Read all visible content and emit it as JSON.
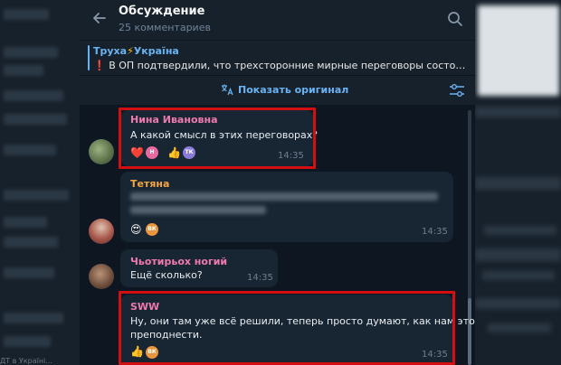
{
  "header": {
    "title": "Обсуждение",
    "subtitle": "25 комментариев"
  },
  "pinned": {
    "channel_part1": "Труха",
    "channel_emoji": "⚡",
    "channel_part2": "Україна",
    "mark": "❗",
    "text": "В ОП подтвердили, что трехсторонние мирные переговоры состоятся в ..."
  },
  "translate_bar": {
    "label": "Показать оригинал"
  },
  "messages": [
    {
      "author": "Нина Ивановна",
      "author_color": "#ee7aae",
      "text": "А какой смысл в этих переговорах?",
      "time": "14:35",
      "reactions": [
        {
          "emoji": "❤️",
          "avatar_initial": "Н",
          "avatar_color": "#e96a9e"
        },
        {
          "emoji": "👍",
          "avatar_initial": "ТК",
          "avatar_color": "#8a7bd9"
        }
      ]
    },
    {
      "author": "Тетяна",
      "author_color": "#f5a442",
      "time": "14:35",
      "reactions": [
        {
          "emoji": "😍",
          "avatar_initial": "ВК",
          "avatar_color": "#e9953d"
        }
      ]
    },
    {
      "author": "Чьотирьох ногий",
      "author_color": "#ee7aae",
      "text": "Ещё сколько?",
      "time": "14:35"
    },
    {
      "author": "SWW",
      "author_color": "#ee7aae",
      "text_line1": "Ну, они там уже всё решили, теперь просто думают, как нам это",
      "text_line2": "преподнести.",
      "time": "14:35",
      "reactions": [
        {
          "emoji": "👍",
          "avatar_initial": "ВК",
          "avatar_color": "#e9953d"
        }
      ]
    }
  ],
  "sidebar": {
    "tail_text": "ДТ в Україні..."
  },
  "colors": {
    "accent": "#6ab3f3",
    "highlight": "#d40f12",
    "bubble": "#182533"
  }
}
